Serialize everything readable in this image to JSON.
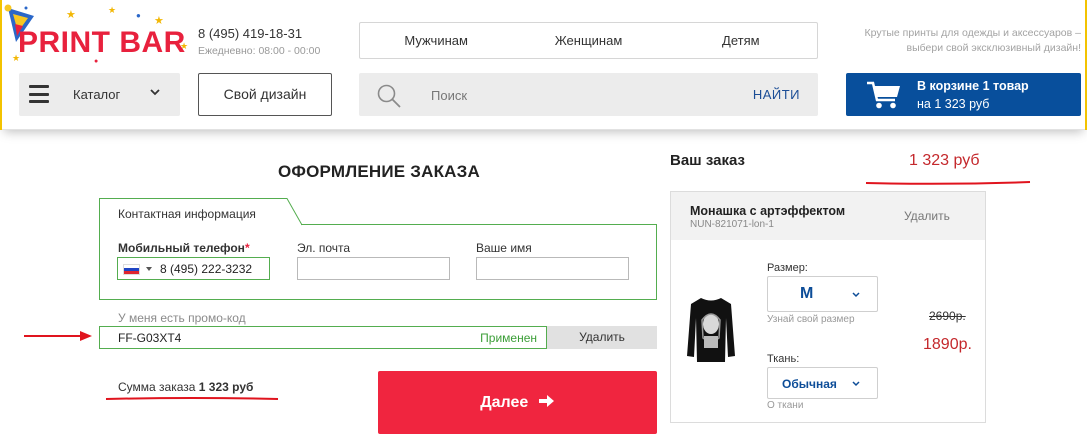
{
  "header": {
    "logo_text": "PRINT BAR",
    "phone": "8 (495) 419-18-31",
    "hours": "Ежедневно: 08:00 - 00:00",
    "nav": [
      "Мужчинам",
      "Женщинам",
      "Детям"
    ],
    "tagline_line1": "Крутые принты для одежды и аксессуаров –",
    "tagline_line2": "выбери свой эксклюзивный дизайн!",
    "catalog_label": "Каталог",
    "design_button": "Свой дизайн",
    "search_placeholder": "Поиск",
    "search_button": "НАЙТИ",
    "cart_line1": "В корзине 1 товар",
    "cart_line2": "на 1 323 руб"
  },
  "checkout": {
    "title": "ОФОРМЛЕНИЕ ЗАКАЗА",
    "contact_tab": "Контактная информация",
    "phone_label": "Мобильный телефон",
    "phone_required_mark": "*",
    "phone_value": "8 (495) 222-3232",
    "email_label": "Эл. почта",
    "email_value": "",
    "name_label": "Ваше имя",
    "name_value": "",
    "promo_label": "У меня есть промо-код",
    "promo_code": "FF-G03XT4",
    "promo_status": "Применен",
    "promo_delete": "Удалить",
    "sum_label": "Сумма заказа",
    "sum_value": "1 323 руб",
    "next_button": "Далее"
  },
  "order": {
    "title": "Ваш заказ",
    "total": "1 323 руб",
    "item": {
      "name": "Монашка с артэффектом",
      "sku": "NUN-821071-lon-1",
      "delete": "Удалить",
      "size_label": "Размер:",
      "size_value": "M",
      "size_hint": "Узнай свой размер",
      "fabric_label": "Ткань:",
      "fabric_value": "Обычная",
      "fabric_hint": "О ткани",
      "old_price": "2690р.",
      "new_price": "1890р."
    }
  },
  "colors": {
    "brand_red": "#e8213d",
    "brand_blue": "#084f9c",
    "success_green": "#54ad4f",
    "annotation_red": "#e0141e"
  }
}
